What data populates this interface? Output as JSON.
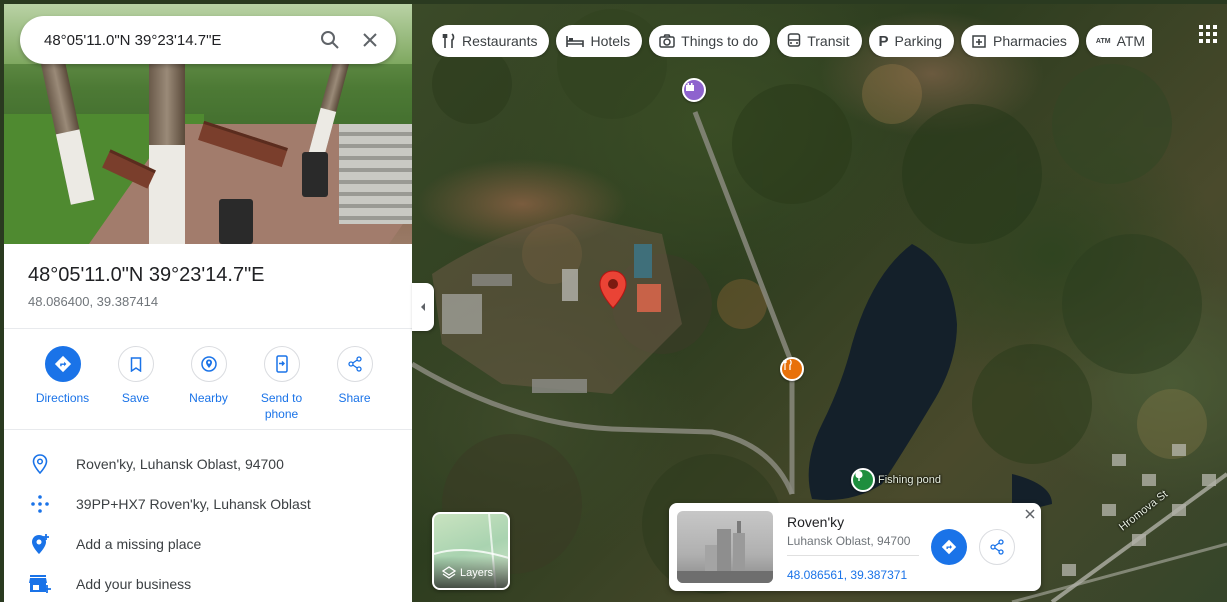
{
  "search": {
    "query": "48°05'11.0\"N 39°23'14.7\"E"
  },
  "place": {
    "title": "48°05'11.0\"N 39°23'14.7\"E",
    "decimal": "48.086400, 39.387414"
  },
  "actions": [
    {
      "label": "Directions",
      "icon": "directions-icon"
    },
    {
      "label": "Save",
      "icon": "bookmark-icon"
    },
    {
      "label": "Nearby",
      "icon": "nearby-icon"
    },
    {
      "label": "Send to\nphone",
      "icon": "send-to-phone-icon"
    },
    {
      "label": "Share",
      "icon": "share-icon"
    }
  ],
  "info": [
    {
      "text": "Roven'ky, Luhansk Oblast, 94700",
      "icon": "location-pin-icon"
    },
    {
      "text": "39PP+HX7 Roven'ky, Luhansk Oblast",
      "icon": "plus-code-icon"
    },
    {
      "text": "Add a missing place",
      "icon": "add-place-icon"
    },
    {
      "text": "Add your business",
      "icon": "add-business-icon"
    }
  ],
  "chips": [
    {
      "label": "Restaurants",
      "icon": "fork-knife-icon"
    },
    {
      "label": "Hotels",
      "icon": "bed-icon"
    },
    {
      "label": "Things to do",
      "icon": "camera-icon"
    },
    {
      "label": "Transit",
      "icon": "bus-icon"
    },
    {
      "label": "Parking",
      "icon": "parking-icon"
    },
    {
      "label": "Pharmacies",
      "icon": "pharmacy-icon"
    },
    {
      "label": "ATM",
      "icon": "atm-icon"
    }
  ],
  "map": {
    "labels": {
      "fishing_pond": "Fishing pond",
      "street": "Hromova St"
    }
  },
  "layers": {
    "label": "Layers"
  },
  "card": {
    "name": "Roven'ky",
    "subtitle": "Luhansk Oblast, 94700",
    "coords": "48.086561, 39.387371"
  },
  "colors": {
    "accent": "#1a73e8",
    "pin": "#ea4335",
    "restaurant_marker": "#e8710a",
    "museum_marker": "#8e63ce",
    "park_marker": "#1e8e3e"
  }
}
